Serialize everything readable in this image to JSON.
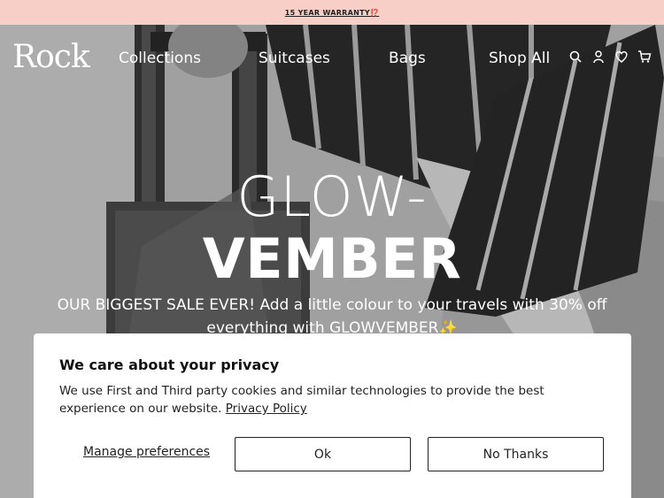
{
  "announcement": {
    "text": "15 YEAR WARRANTY⁉️"
  },
  "nav": {
    "logo": "Rock",
    "links": [
      "Collections",
      "Suitcases",
      "Bags",
      "Shop All"
    ],
    "icons": [
      "search-icon",
      "account-icon",
      "wishlist-icon",
      "cart-icon"
    ]
  },
  "hero": {
    "headline_line1": "GLOW-",
    "headline_line2": "VEMBER",
    "subtext": "OUR BIGGEST SALE EVER! Add a little colour to your travels with 30% off everything with GLOWVEMBER✨"
  },
  "cookie_banner": {
    "title": "We care about your privacy",
    "body": "We use First and Third party cookies and similar technologies to provide the best experience on our website.",
    "policy_link": "Privacy Policy",
    "manage_label": "Manage preferences",
    "ok_label": "Ok",
    "no_thanks_label": "No Thanks"
  },
  "colors": {
    "announcement_bg": "#f7cfc6",
    "text_dark": "#222222",
    "white": "#ffffff"
  }
}
